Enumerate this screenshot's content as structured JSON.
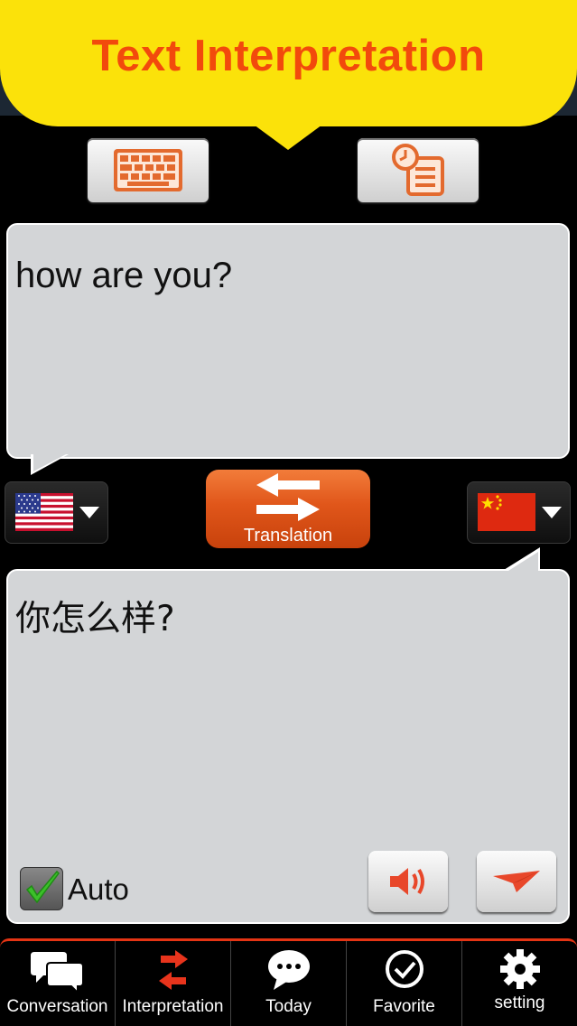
{
  "banner": {
    "title": "Text Interpretation"
  },
  "source": {
    "text": "how are you?"
  },
  "target": {
    "text": "你怎么样?"
  },
  "translate_button": {
    "label": "Translation"
  },
  "auto": {
    "label": "Auto",
    "checked": true
  },
  "tabs": [
    {
      "label": "Conversation",
      "icon": "chat-bubbles-icon",
      "active": false
    },
    {
      "label": "Interpretation",
      "icon": "swap-arrows-icon",
      "active": true
    },
    {
      "label": "Today",
      "icon": "speech-bubble-icon",
      "active": false
    },
    {
      "label": "Favorite",
      "icon": "check-circle-icon",
      "active": false
    },
    {
      "label": "setting",
      "icon": "gear-icon",
      "active": false
    }
  ],
  "colors": {
    "banner_bg": "#fbe20a",
    "banner_text": "#f24a0c",
    "accent": "#e0561a",
    "text_box_bg": "#d3d5d7",
    "tab_active_icon": "#e8341c"
  }
}
